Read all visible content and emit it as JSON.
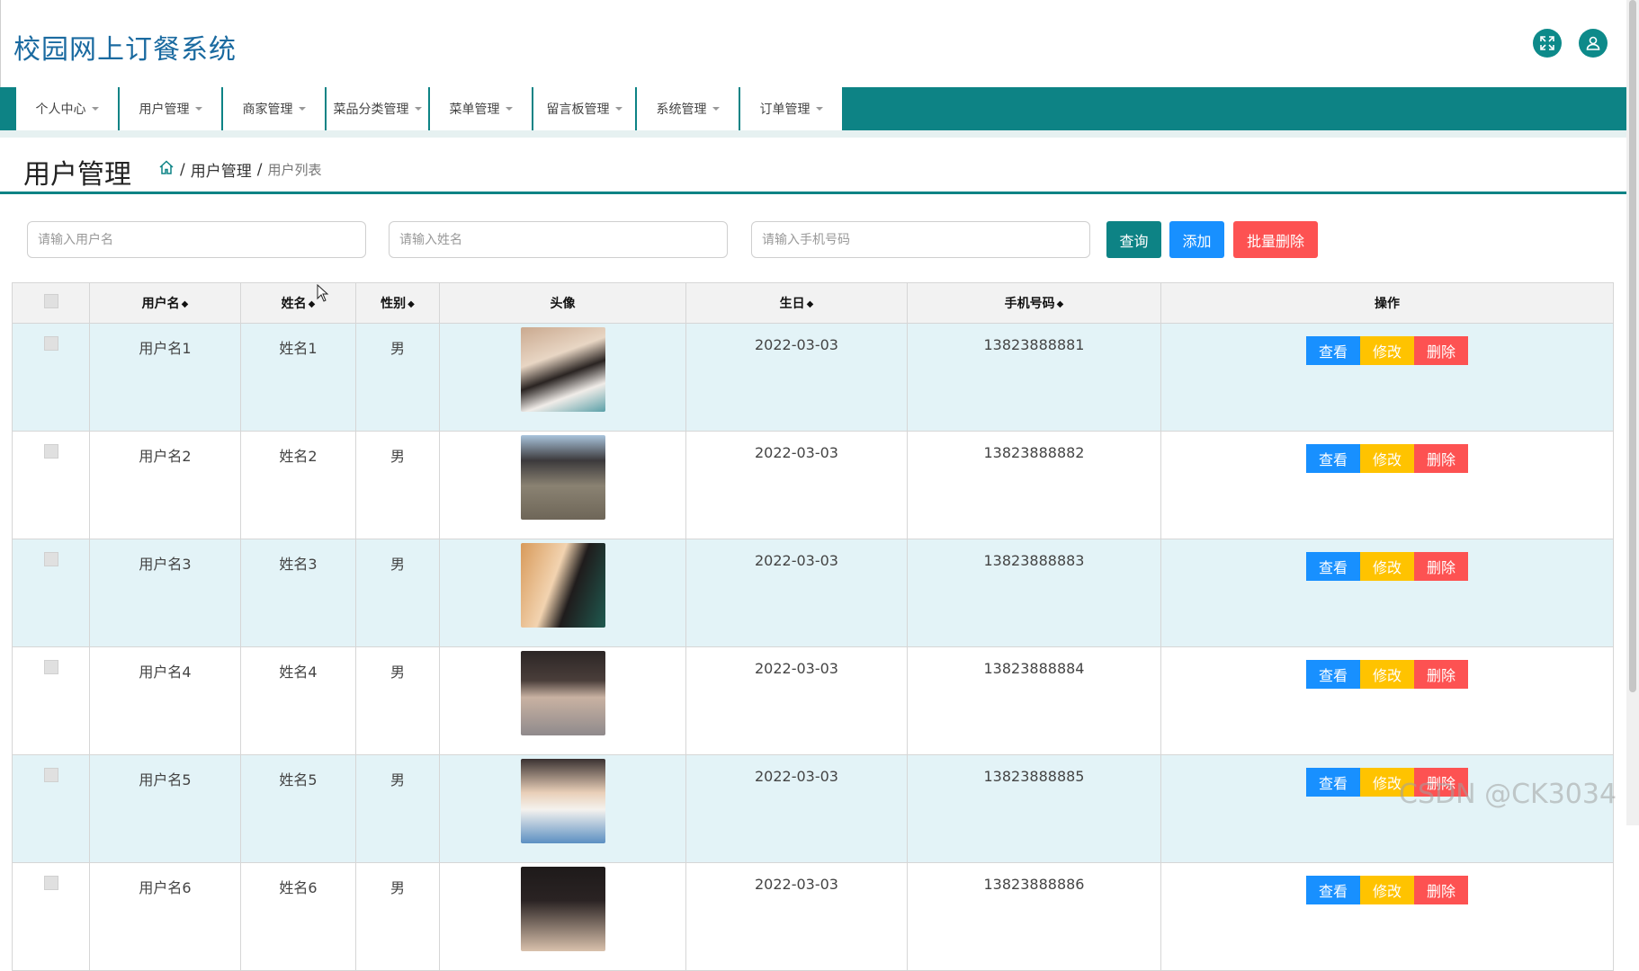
{
  "app": {
    "title": "校园网上订餐系统"
  },
  "nav": {
    "items": [
      {
        "label": "个人中心"
      },
      {
        "label": "用户管理"
      },
      {
        "label": "商家管理"
      },
      {
        "label": "菜品分类管理"
      },
      {
        "label": "菜单管理"
      },
      {
        "label": "留言板管理"
      },
      {
        "label": "系统管理"
      },
      {
        "label": "订单管理"
      }
    ]
  },
  "header": {
    "page_title": "用户管理",
    "breadcrumb": {
      "sep1": "/",
      "level1": "用户管理",
      "sep2": "/",
      "current": "用户列表"
    }
  },
  "search": {
    "username_placeholder": "请输入用户名",
    "name_placeholder": "请输入姓名",
    "phone_placeholder": "请输入手机号码",
    "query_label": "查询",
    "add_label": "添加",
    "batch_delete_label": "批量删除"
  },
  "table": {
    "headers": {
      "username": "用户名",
      "name": "姓名",
      "gender": "性别",
      "avatar": "头像",
      "birthday": "生日",
      "phone": "手机号码",
      "actions": "操作"
    },
    "sort_icon": "◆",
    "actions": {
      "view": "查看",
      "edit": "修改",
      "delete": "删除"
    },
    "rows": [
      {
        "username": "用户名1",
        "name": "姓名1",
        "gender": "男",
        "birthday": "2022-03-03",
        "phone": "13823888881"
      },
      {
        "username": "用户名2",
        "name": "姓名2",
        "gender": "男",
        "birthday": "2022-03-03",
        "phone": "13823888882"
      },
      {
        "username": "用户名3",
        "name": "姓名3",
        "gender": "男",
        "birthday": "2022-03-03",
        "phone": "13823888883"
      },
      {
        "username": "用户名4",
        "name": "姓名4",
        "gender": "男",
        "birthday": "2022-03-03",
        "phone": "13823888884"
      },
      {
        "username": "用户名5",
        "name": "姓名5",
        "gender": "男",
        "birthday": "2022-03-03",
        "phone": "13823888885"
      },
      {
        "username": "用户名6",
        "name": "姓名6",
        "gender": "男",
        "birthday": "2022-03-03",
        "phone": "13823888886"
      }
    ]
  },
  "watermark": "CSDN @CK3034",
  "colors": {
    "primary_teal": "#0d8385",
    "add_blue": "#1890ff",
    "delete_red": "#fd5252",
    "edit_yellow": "#ffc300",
    "row_highlight": "#e3f3f7"
  }
}
